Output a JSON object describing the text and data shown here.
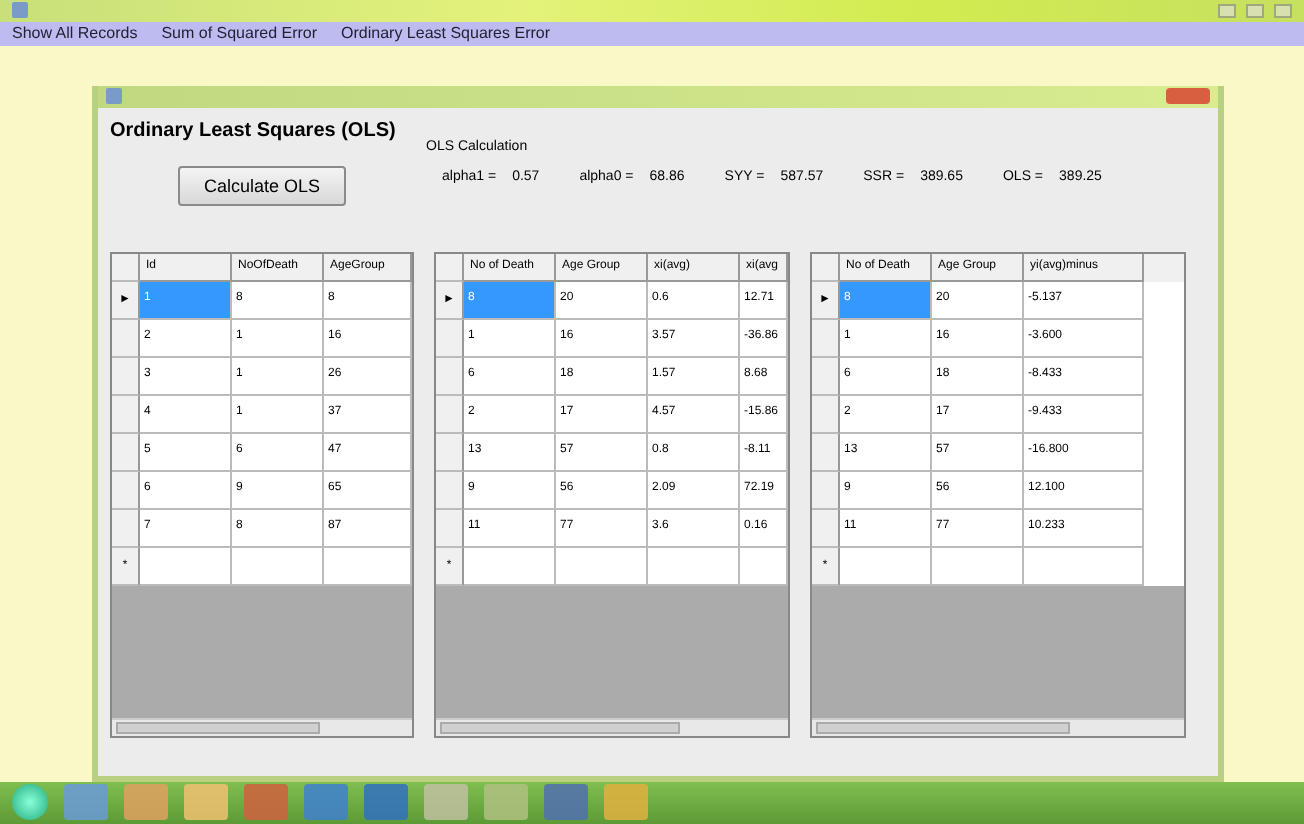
{
  "menu": [
    "Show All Records",
    "Sum of Squared Error",
    "Ordinary Least Squares Error"
  ],
  "panel": {
    "heading": "Ordinary Least Squares (OLS)",
    "button": "Calculate OLS",
    "calc_label": "OLS Calculation",
    "results": [
      {
        "label": "alpha1 =",
        "value": "0.57"
      },
      {
        "label": "alpha0 =",
        "value": "68.86"
      },
      {
        "label": "SYY =",
        "value": "587.57"
      },
      {
        "label": "SSR =",
        "value": "389.65"
      },
      {
        "label": "OLS =",
        "value": "389.25"
      }
    ]
  },
  "current_marker": "►",
  "new_row_marker": "*",
  "grids": [
    {
      "columns": [
        "Id",
        "NoOfDeath",
        "AgeGroup"
      ],
      "rows": [
        {
          "cells": [
            "1",
            "8",
            "8"
          ],
          "selected": true
        },
        {
          "cells": [
            "2",
            "1",
            "16"
          ],
          "selected": false
        },
        {
          "cells": [
            "3",
            "1",
            "26"
          ],
          "selected": false
        },
        {
          "cells": [
            "4",
            "1",
            "37"
          ],
          "selected": false
        },
        {
          "cells": [
            "5",
            "6",
            "47"
          ],
          "selected": false
        },
        {
          "cells": [
            "6",
            "9",
            "65"
          ],
          "selected": false
        },
        {
          "cells": [
            "7",
            "8",
            "87"
          ],
          "selected": false
        }
      ]
    },
    {
      "columns": [
        "No of Death",
        "Age Group",
        "xi(avg)",
        "xi(avg"
      ],
      "rows": [
        {
          "cells": [
            "8",
            "20",
            "0.6",
            "12.71"
          ],
          "selected": true
        },
        {
          "cells": [
            "1",
            "16",
            "3.57",
            "-36.86"
          ],
          "selected": false
        },
        {
          "cells": [
            "6",
            "18",
            "1.57",
            "8.68"
          ],
          "selected": false
        },
        {
          "cells": [
            "2",
            "17",
            "4.57",
            "-15.86"
          ],
          "selected": false
        },
        {
          "cells": [
            "13",
            "57",
            "0.8",
            "-8.11"
          ],
          "selected": false
        },
        {
          "cells": [
            "9",
            "56",
            "2.09",
            "72.19"
          ],
          "selected": false
        },
        {
          "cells": [
            "11",
            "77",
            "3.6",
            "0.16"
          ],
          "selected": false
        }
      ]
    },
    {
      "columns": [
        "No of Death",
        "Age Group",
        "yi(avg)minus"
      ],
      "rows": [
        {
          "cells": [
            "8",
            "20",
            "-5.137"
          ],
          "selected": true
        },
        {
          "cells": [
            "1",
            "16",
            "-3.600"
          ],
          "selected": false
        },
        {
          "cells": [
            "6",
            "18",
            "-8.433"
          ],
          "selected": false
        },
        {
          "cells": [
            "2",
            "17",
            "-9.433"
          ],
          "selected": false
        },
        {
          "cells": [
            "13",
            "57",
            "-16.800"
          ],
          "selected": false
        },
        {
          "cells": [
            "9",
            "56",
            "12.100"
          ],
          "selected": false
        },
        {
          "cells": [
            "11",
            "77",
            "10.233"
          ],
          "selected": false
        }
      ]
    }
  ]
}
